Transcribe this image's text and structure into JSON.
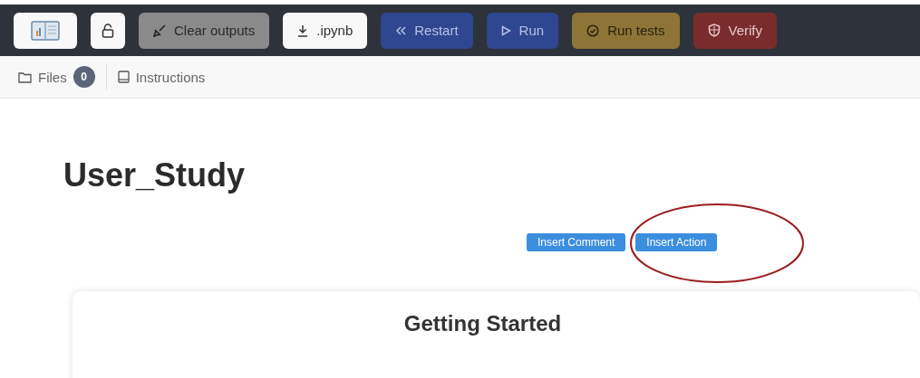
{
  "toolbar": {
    "buttons": [
      {
        "kind": "logo"
      },
      {
        "kind": "lock"
      },
      {
        "kind": "clear",
        "label": "Clear outputs"
      },
      {
        "kind": "download",
        "label": ".ipynb"
      },
      {
        "kind": "restart",
        "label": "Restart"
      },
      {
        "kind": "run",
        "label": "Run"
      },
      {
        "kind": "tests",
        "label": "Run tests"
      },
      {
        "kind": "verify",
        "label": "Verify"
      }
    ]
  },
  "tabs": [
    {
      "kind": "files",
      "label": "Files",
      "badge": "0"
    },
    {
      "kind": "instructions",
      "label": "Instructions"
    }
  ],
  "notebook": {
    "title": "User_Study",
    "actions": [
      "Insert Comment",
      "Insert Action"
    ],
    "highlight": true,
    "card": {
      "heading": "Getting Started"
    }
  }
}
